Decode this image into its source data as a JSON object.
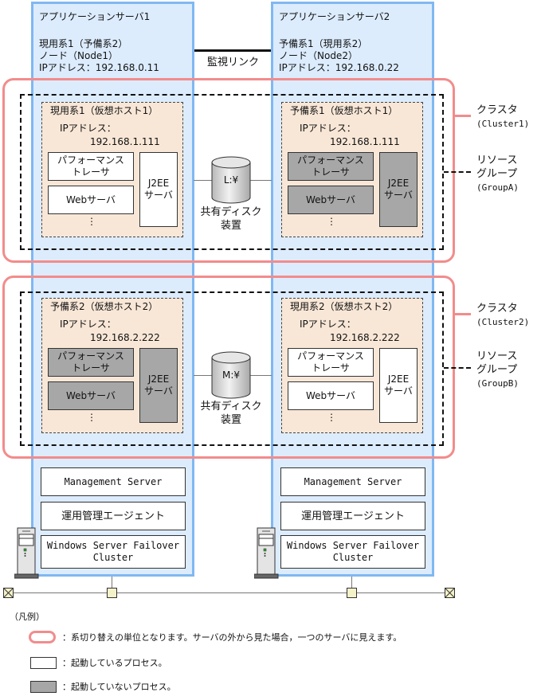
{
  "servers": [
    {
      "title": "アプリケーションサーバ1",
      "role": "現用系1（予備系2）",
      "node": "ノード（Node1）",
      "ip": "IPアドレス：192.168.0.11",
      "base": {
        "management_server": "Management Server",
        "agent": "運用管理エージェント",
        "failover": [
          "Windows Server Failover",
          "Cluster"
        ]
      }
    },
    {
      "title": "アプリケーションサーバ2",
      "role": "予備系1（現用系2）",
      "node": "ノード（Node2）",
      "ip": "IPアドレス：192.168.0.22",
      "base": {
        "management_server": "Management Server",
        "agent": "運用管理エージェント",
        "failover": [
          "Windows Server Failover",
          "Cluster"
        ]
      }
    }
  ],
  "monitor_link": "監視リンク",
  "clusters": [
    {
      "label": "クラスタ",
      "sub": "(Cluster1)",
      "group_label": [
        "リソース",
        "グループ",
        "(GroupA)"
      ],
      "disk": {
        "drive": "L:¥",
        "label": [
          "共有ディスク",
          "装置"
        ]
      },
      "hosts": [
        {
          "title": "現用系1（仮想ホスト1）",
          "ip_label": "IPアドレス：",
          "ip": "192.168.1.111",
          "state": "running",
          "perf": [
            "パフォーマンス",
            "トレーサ"
          ],
          "web": "Webサーバ",
          "j2ee": [
            "J2EE",
            "サーバ"
          ],
          "more": "⋮"
        },
        {
          "title": "予備系1（仮想ホスト1）",
          "ip_label": "IPアドレス：",
          "ip": "192.168.1.111",
          "state": "stopped",
          "perf": [
            "パフォーマンス",
            "トレーサ"
          ],
          "web": "Webサーバ",
          "j2ee": [
            "J2EE",
            "サーバ"
          ],
          "more": "⋮"
        }
      ]
    },
    {
      "label": "クラスタ",
      "sub": "(Cluster2)",
      "group_label": [
        "リソース",
        "グループ",
        "(GroupB)"
      ],
      "disk": {
        "drive": "M:¥",
        "label": [
          "共有ディスク",
          "装置"
        ]
      },
      "hosts": [
        {
          "title": "予備系2（仮想ホスト2）",
          "ip_label": "IPアドレス：",
          "ip": "192.168.2.222",
          "state": "stopped",
          "perf": [
            "パフォーマンス",
            "トレーサ"
          ],
          "web": "Webサーバ",
          "j2ee": [
            "J2EE",
            "サーバ"
          ],
          "more": "⋮"
        },
        {
          "title": "現用系2（仮想ホスト2）",
          "ip_label": "IPアドレス：",
          "ip": "192.168.2.222",
          "state": "running",
          "perf": [
            "パフォーマンス",
            "トレーサ"
          ],
          "web": "Webサーバ",
          "j2ee": [
            "J2EE",
            "サーバ"
          ],
          "more": "⋮"
        }
      ]
    }
  ],
  "legend": {
    "title": "（凡例）",
    "items": [
      {
        "symbol": "failover-unit",
        "text": "：系切り替えの単位となります。サーバの外から見た場合，一つのサーバに見えます。"
      },
      {
        "symbol": "running-process",
        "text": "：起動しているプロセス。"
      },
      {
        "symbol": "stopped-process",
        "text": "：起動していないプロセス。"
      }
    ]
  },
  "colors": {
    "server_fill": "#dcecfd",
    "server_border": "#80b8f2",
    "cluster_border": "#f28c8c",
    "vhost_fill": "#f8e7d7",
    "stopped_fill": "#a7a7a7",
    "hub_fill": "#f4f2c8"
  }
}
